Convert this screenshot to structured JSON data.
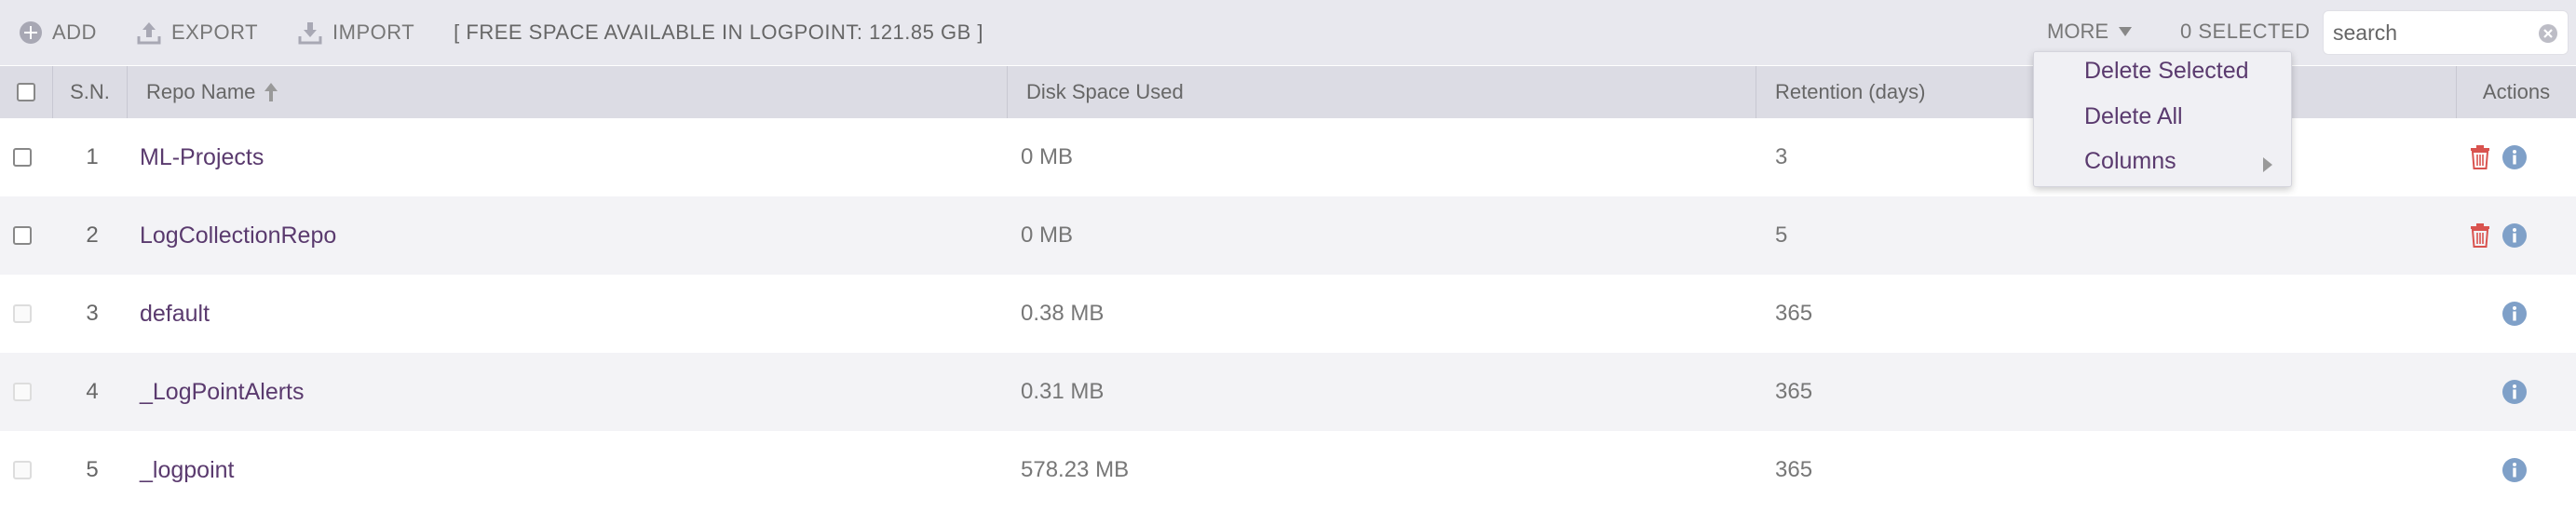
{
  "toolbar": {
    "add_label": "ADD",
    "export_label": "EXPORT",
    "import_label": "IMPORT",
    "free_space": "[ FREE SPACE AVAILABLE IN LOGPOINT: 121.85 GB ]",
    "more_label": "MORE",
    "selected_count": "0 SELECTED",
    "search_placeholder": "search"
  },
  "table": {
    "headers": {
      "sn": "S.N.",
      "name": "Repo Name",
      "disk": "Disk Space Used",
      "retention": "Retention (days)",
      "actions": "Actions"
    },
    "rows": [
      {
        "sn": "1",
        "name": "ML-Projects",
        "disk": "0 MB",
        "retention": "3",
        "deletable": true
      },
      {
        "sn": "2",
        "name": "LogCollectionRepo",
        "disk": "0 MB",
        "retention": "5",
        "deletable": true
      },
      {
        "sn": "3",
        "name": "default",
        "disk": "0.38 MB",
        "retention": "365",
        "deletable": false
      },
      {
        "sn": "4",
        "name": "_LogPointAlerts",
        "disk": "0.31 MB",
        "retention": "365",
        "deletable": false
      },
      {
        "sn": "5",
        "name": "_logpoint",
        "disk": "578.23 MB",
        "retention": "365",
        "deletable": false
      }
    ]
  },
  "more_menu": {
    "items": [
      "Delete Selected",
      "Delete All",
      "Columns"
    ]
  },
  "colors": {
    "link": "#5a3a6e",
    "delete_icon": "#d9534f",
    "info_icon": "#7fa0c8",
    "toolbar_bg": "#e8e8ee",
    "header_bg": "#dcdce4"
  },
  "icons": {
    "add": "plus-circle-icon",
    "export": "upload-icon",
    "import": "download-icon",
    "sort": "sort-up-arrow-icon",
    "delete": "trash-icon",
    "info": "info-circle-icon",
    "clear": "clear-x-icon",
    "dropdown": "caret-down-icon",
    "submenu": "caret-right-icon"
  }
}
